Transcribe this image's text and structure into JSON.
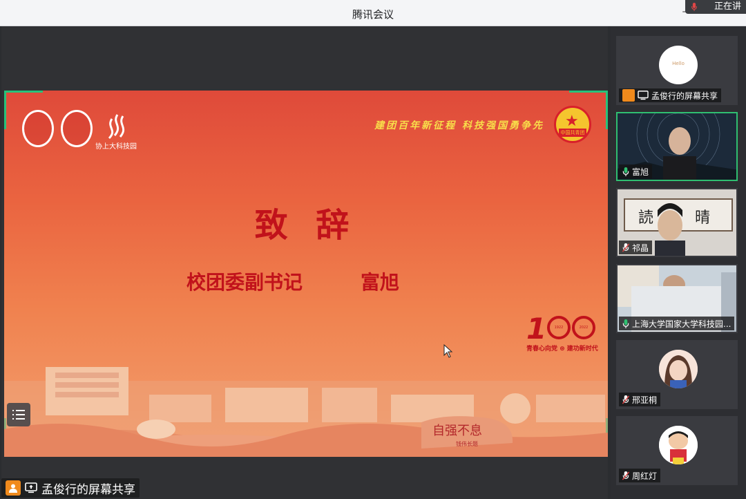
{
  "window": {
    "title": "腾讯会议",
    "speaking_label": "正在讲"
  },
  "share_badge": {
    "label": "孟俊行的屏幕共享"
  },
  "slide": {
    "slogan": "建团百年新征程 科技强国勇争先",
    "logo_caption": "协上大科技园",
    "heading": "致 辞",
    "subheading": "校团委副书记",
    "speaker": "富旭",
    "badge_text": "中国共青团",
    "centennial_number": "1",
    "centennial_years": [
      "1922",
      "2022"
    ],
    "centennial_slogan": "青春心向党 ⊛ 建功新时代",
    "rock_text": "自强不息",
    "rock_sub": "钱伟长题",
    "accent_color": "#c1121b"
  },
  "participants": [
    {
      "name": "孟俊行的屏幕共享",
      "avatar_text": "Hello",
      "type": "share",
      "mic": "none"
    },
    {
      "name": "富旭",
      "type": "video",
      "mic": "on",
      "active": true
    },
    {
      "name": "祁晶",
      "type": "video",
      "mic": "muted"
    },
    {
      "name": "上海大学国家大学科技园...",
      "type": "video",
      "mic": "on"
    },
    {
      "name": "邢亚桐",
      "type": "avatar",
      "mic": "muted"
    },
    {
      "name": "周红灯",
      "type": "avatar",
      "mic": "muted"
    }
  ],
  "colors": {
    "active_border": "#2fbf71",
    "share_orange": "#f08a1c"
  }
}
